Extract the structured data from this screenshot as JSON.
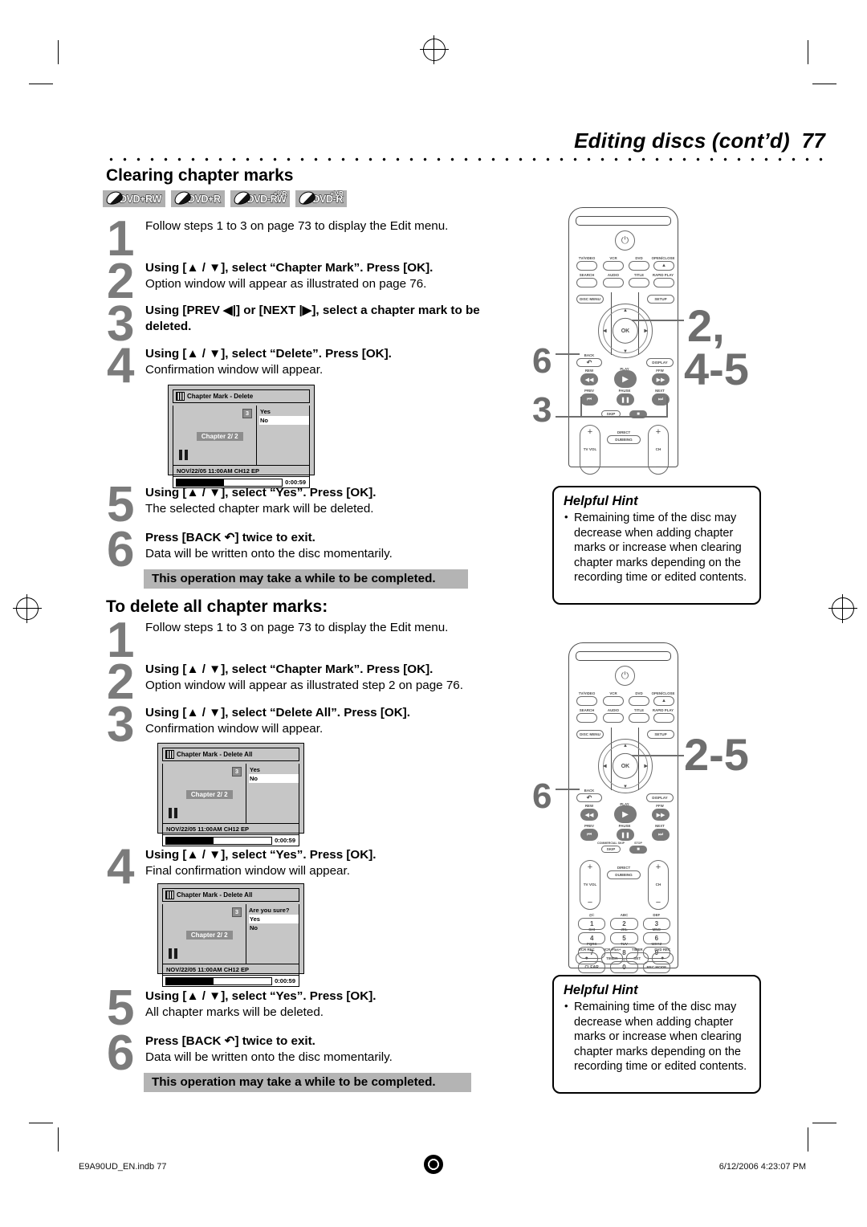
{
  "header": {
    "title": "Editing discs (cont’d)",
    "page_number": "77"
  },
  "section1": {
    "heading": "Clearing chapter marks",
    "badges": [
      {
        "label": "DVD+RW",
        "vr": ""
      },
      {
        "label": "DVD+R",
        "vr": ""
      },
      {
        "label": "DVD-RW",
        "vr": "+VR"
      },
      {
        "label": "DVD-R",
        "vr": "+VR"
      }
    ],
    "steps": [
      {
        "num": "1",
        "bold": "",
        "sub": "Follow steps 1 to 3 on page 73 to display the Edit menu."
      },
      {
        "num": "2",
        "bold": "Using [▲ / ▼], select “Chapter Mark”. Press [OK].",
        "sub": "Option window will appear as illustrated on page 76."
      },
      {
        "num": "3",
        "bold": "Using [PREV ◀|] or [NEXT |▶], select a chapter mark to be deleted.",
        "sub": ""
      },
      {
        "num": "4",
        "bold": "Using [▲ / ▼], select “Delete”. Press [OK].",
        "sub": "Confirmation window will appear."
      },
      {
        "num": "5",
        "bold": "Using [▲ / ▼], select “Yes”. Press [OK].",
        "sub": "The selected chapter mark will be deleted."
      },
      {
        "num": "6",
        "bold": "Press [BACK ↶] twice to exit.",
        "sub": "Data will be written onto the disc momentarily."
      }
    ],
    "note": "This operation may take a while to be completed."
  },
  "section2": {
    "heading": "To delete all chapter marks:",
    "steps": [
      {
        "num": "1",
        "bold": "",
        "sub": "Follow steps 1 to 3 on page 73 to display the Edit menu."
      },
      {
        "num": "2",
        "bold": "Using [▲ / ▼], select “Chapter Mark”. Press [OK].",
        "sub": "Option window will appear as illustrated step 2 on page 76."
      },
      {
        "num": "3",
        "bold": "Using [▲ / ▼], select “Delete All”. Press [OK].",
        "sub": "Confirmation window will appear."
      },
      {
        "num": "4",
        "bold": "Using [▲ / ▼], select “Yes”. Press [OK].",
        "sub": "Final confirmation window will appear."
      },
      {
        "num": "5",
        "bold": "Using [▲ / ▼], select “Yes”. Press [OK].",
        "sub": "All chapter marks will be deleted."
      },
      {
        "num": "6",
        "bold": "Press [BACK ↶] twice to exit.",
        "sub": "Data will be written onto the disc momentarily."
      }
    ],
    "note": "This operation may take a while to be completed."
  },
  "tv_screens": [
    {
      "title": "Chapter Mark  -  Delete",
      "number_tag": "3",
      "chapter_tag": "Chapter    2/ 2",
      "question": "",
      "options": [
        "Yes",
        "No"
      ],
      "selected_option": "No",
      "info": "NOV/22/05 11:00AM CH12 EP",
      "time": "0:00:59",
      "progress_percent": 45
    },
    {
      "title": "Chapter Mark  -  Delete All",
      "number_tag": "3",
      "chapter_tag": "Chapter    2/ 2",
      "question": "",
      "options": [
        "Yes",
        "No"
      ],
      "selected_option": "No",
      "info": "NOV/22/05 11:00AM CH12 EP",
      "time": "0:00:59",
      "progress_percent": 45
    },
    {
      "title": "Chapter Mark  -  Delete All",
      "number_tag": "3",
      "chapter_tag": "Chapter    2/ 2",
      "question": "Are you sure?",
      "options": [
        "Yes",
        "No"
      ],
      "selected_option": "Yes",
      "info": "NOV/22/05 11:00AM CH12 EP",
      "time": "0:00:59",
      "progress_percent": 45
    }
  ],
  "remote": {
    "power_icon": "power-icon",
    "row1": [
      "TV/VIDEO",
      "VCR",
      "DVD",
      "OPEN/CLOSE"
    ],
    "row2": [
      "SEARCH",
      "AUDIO",
      "TITLE",
      "RAPID PLAY"
    ],
    "disc_menu": "DISC MENU",
    "setup": "SETUP",
    "ok": "OK",
    "back": "BACK",
    "display": "DISPLAY",
    "rew": "REW",
    "play": "PLAY",
    "ffw": "FFW",
    "prev": "PREV",
    "pause": "PAUSE",
    "next": "NEXT",
    "skip": "SKIP",
    "commercial_skip": "COMMERCIAL SKIP",
    "stop": "STOP",
    "tv_vol": "TV VOL",
    "direct_dubbing": "DIRECT DUBBING",
    "ch": "CH",
    "numbers": [
      {
        "key": "1",
        "letters": "@/:"
      },
      {
        "key": "2",
        "letters": "ABC"
      },
      {
        "key": "3",
        "letters": "DEF"
      },
      {
        "key": "4",
        "letters": "GHI"
      },
      {
        "key": "5",
        "letters": "JKL"
      },
      {
        "key": "6",
        "letters": "MNO"
      },
      {
        "key": "7",
        "letters": "PQRS"
      },
      {
        "key": "8",
        "letters": "TUV"
      },
      {
        "key": "9",
        "letters": "WXYZ"
      },
      {
        "key": "CLEAR",
        "letters": ""
      },
      {
        "key": "0",
        "letters": "␣"
      },
      {
        "key": "REC MODE",
        "letters": ""
      }
    ],
    "bottom_row": [
      {
        "key": "●",
        "letters": "VCR REC"
      },
      {
        "key": "TIMER",
        "letters": "VCR Plus+"
      },
      {
        "key": "SET",
        "letters": "TIMER"
      },
      {
        "key": "●",
        "letters": "DVD REC"
      }
    ]
  },
  "callouts": {
    "remote1": [
      {
        "label": "2,",
        "target": "ok-button"
      },
      {
        "label": "4-5",
        "target": "ok-button"
      },
      {
        "label": "6",
        "target": "back-button"
      },
      {
        "label": "3",
        "target": "prev-next-buttons"
      }
    ],
    "remote2": [
      {
        "label": "2-5",
        "target": "ok-button"
      },
      {
        "label": "6",
        "target": "back-button"
      }
    ]
  },
  "hints": [
    {
      "title": "Helpful Hint",
      "items": [
        "Remaining time of the disc may decrease when adding chapter marks or increase when clearing chapter marks depending on the recording time or edited contents."
      ]
    },
    {
      "title": "Helpful Hint",
      "items": [
        "Remaining time of the disc may decrease when adding chapter marks or increase when clearing chapter marks depending on the recording time or edited contents."
      ]
    }
  ],
  "footer": {
    "file": "E9A90UD_EN.indb   77",
    "timestamp": "6/12/2006   4:23:07 PM"
  }
}
